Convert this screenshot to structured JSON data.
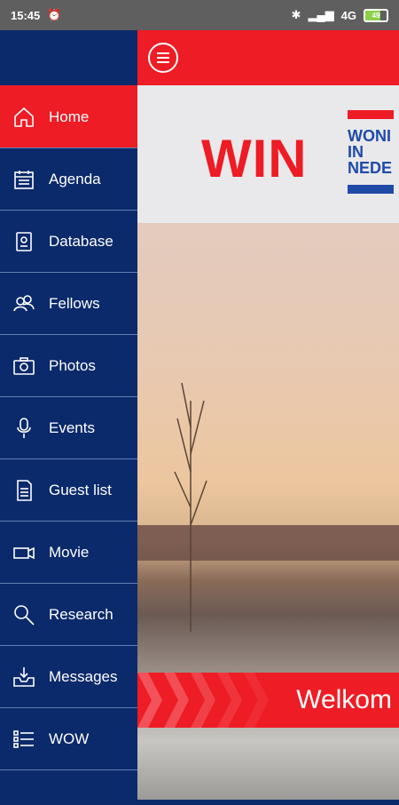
{
  "status_bar": {
    "time": "15:45",
    "network": "4G",
    "battery": "49"
  },
  "sidebar": {
    "items": [
      {
        "label": "Home",
        "icon": "home-icon",
        "active": true
      },
      {
        "label": "Agenda",
        "icon": "calendar-icon"
      },
      {
        "label": "Database",
        "icon": "database-icon"
      },
      {
        "label": "Fellows",
        "icon": "people-icon"
      },
      {
        "label": "Photos",
        "icon": "camera-icon"
      },
      {
        "label": "Events",
        "icon": "microphone-icon"
      },
      {
        "label": "Guest list",
        "icon": "document-icon"
      },
      {
        "label": "Movie",
        "icon": "video-icon"
      },
      {
        "label": "Research",
        "icon": "search-icon"
      },
      {
        "label": "Messages",
        "icon": "inbox-icon"
      },
      {
        "label": "WOW",
        "icon": "list-icon"
      }
    ]
  },
  "header": {
    "menu_icon": "hamburger-icon"
  },
  "logo": {
    "main": "WIN",
    "line1": "WONI",
    "line2": "IN",
    "line3": "NEDE"
  },
  "banner": {
    "text": "Welkom"
  },
  "colors": {
    "brand_red": "#ee1c24",
    "brand_blue": "#0b2a6b"
  }
}
